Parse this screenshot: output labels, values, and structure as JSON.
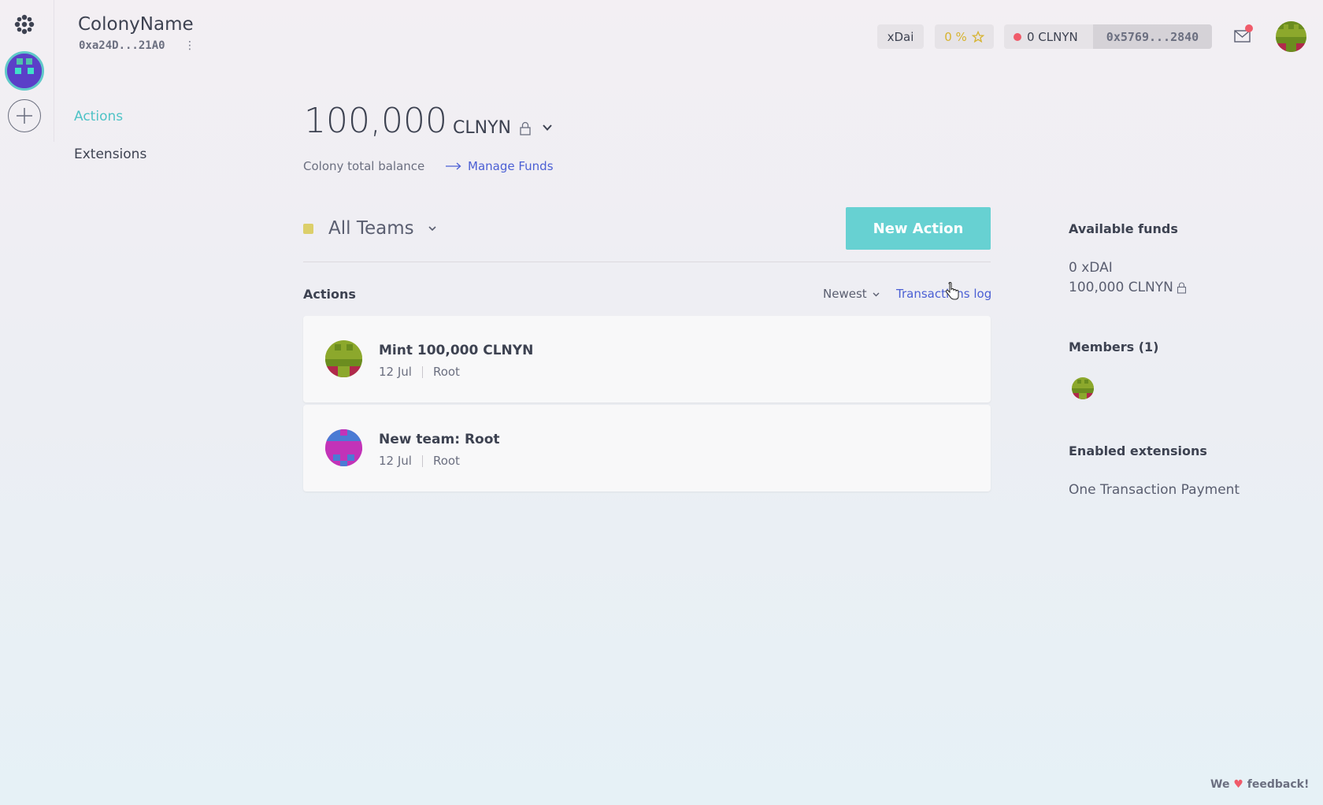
{
  "colony": {
    "name": "ColonyName",
    "address": "0xa24D...21A0",
    "menu_glyph": "⋮"
  },
  "nav": {
    "items": [
      {
        "label": "Actions",
        "active": true
      },
      {
        "label": "Extensions",
        "active": false
      }
    ]
  },
  "topbar": {
    "network": "xDai",
    "reputation": "0 %",
    "reputation_icon": "star-icon",
    "wallet_balance": "0 CLNYN",
    "wallet_address": "0x5769...2840",
    "inbox_icon": "mail-icon"
  },
  "balance": {
    "amount": "100,000",
    "token": "CLNYN",
    "label": "Colony total balance",
    "manage_funds": "Manage Funds"
  },
  "teams": {
    "selected": "All Teams",
    "new_action": "New Action"
  },
  "actions": {
    "heading": "Actions",
    "sort": "Newest",
    "transactions_log": "Transactions log",
    "items": [
      {
        "title": "Mint 100,000 CLNYN",
        "date": "12 Jul",
        "team": "Root"
      },
      {
        "title": "New team: Root",
        "date": "12 Jul",
        "team": "Root"
      }
    ]
  },
  "sidebar_right": {
    "available_funds_heading": "Available funds",
    "funds": [
      "0 xDAI",
      "100,000 CLNYN"
    ],
    "members_heading": "Members (1)",
    "extensions_heading": "Enabled extensions",
    "extensions": [
      "One Transaction Payment"
    ]
  },
  "feedback": {
    "prefix": "We",
    "heart": "♥",
    "suffix": "feedback!"
  },
  "colors": {
    "accent": "#67d1d2",
    "link": "#4b5fd4",
    "alert": "#f05b6a",
    "reputation": "#d7b32f",
    "team": "#dccf6a"
  }
}
